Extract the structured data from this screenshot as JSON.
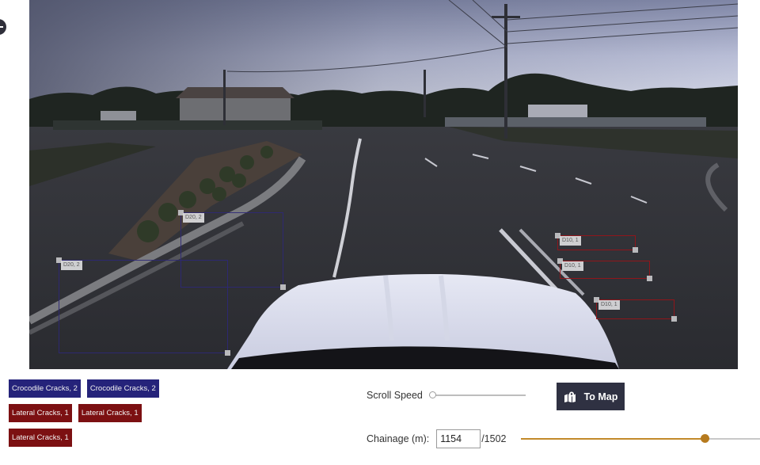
{
  "viewer": {
    "detections": [
      {
        "id": "det-1",
        "type": "crocodile",
        "label": "D20, 2"
      },
      {
        "id": "det-2",
        "type": "crocodile",
        "label": "D20, 2"
      },
      {
        "id": "det-3",
        "type": "lateral",
        "label": "D10, 1"
      },
      {
        "id": "det-4",
        "type": "lateral",
        "label": "D10, 1"
      },
      {
        "id": "det-5",
        "type": "lateral",
        "label": "D10, 1"
      }
    ]
  },
  "legend": {
    "rows": [
      [
        {
          "label": "Crocodile Cracks, 2",
          "type": "crocodile"
        },
        {
          "label": "Crocodile Cracks, 2",
          "type": "crocodile"
        }
      ],
      [
        {
          "label": "Lateral Cracks, 1",
          "type": "lateral"
        },
        {
          "label": "Lateral Cracks, 1",
          "type": "lateral"
        }
      ],
      [
        {
          "label": "Lateral Cracks, 1",
          "type": "lateral"
        }
      ]
    ]
  },
  "controls": {
    "scroll_speed_label": "Scroll Speed",
    "scroll_speed_value": 0,
    "to_map_label": "To Map",
    "to_map_icon": "map-icon",
    "chainage_label": "Chainage (m):",
    "chainage_value": "1154",
    "chainage_total": "/1502",
    "chainage_current": 1154,
    "chainage_max": 1502
  },
  "colors": {
    "crocodile": "#25237a",
    "lateral": "#7c1012",
    "to_map_bg": "#2f3142",
    "chainage_accent": "#b67a1e"
  }
}
